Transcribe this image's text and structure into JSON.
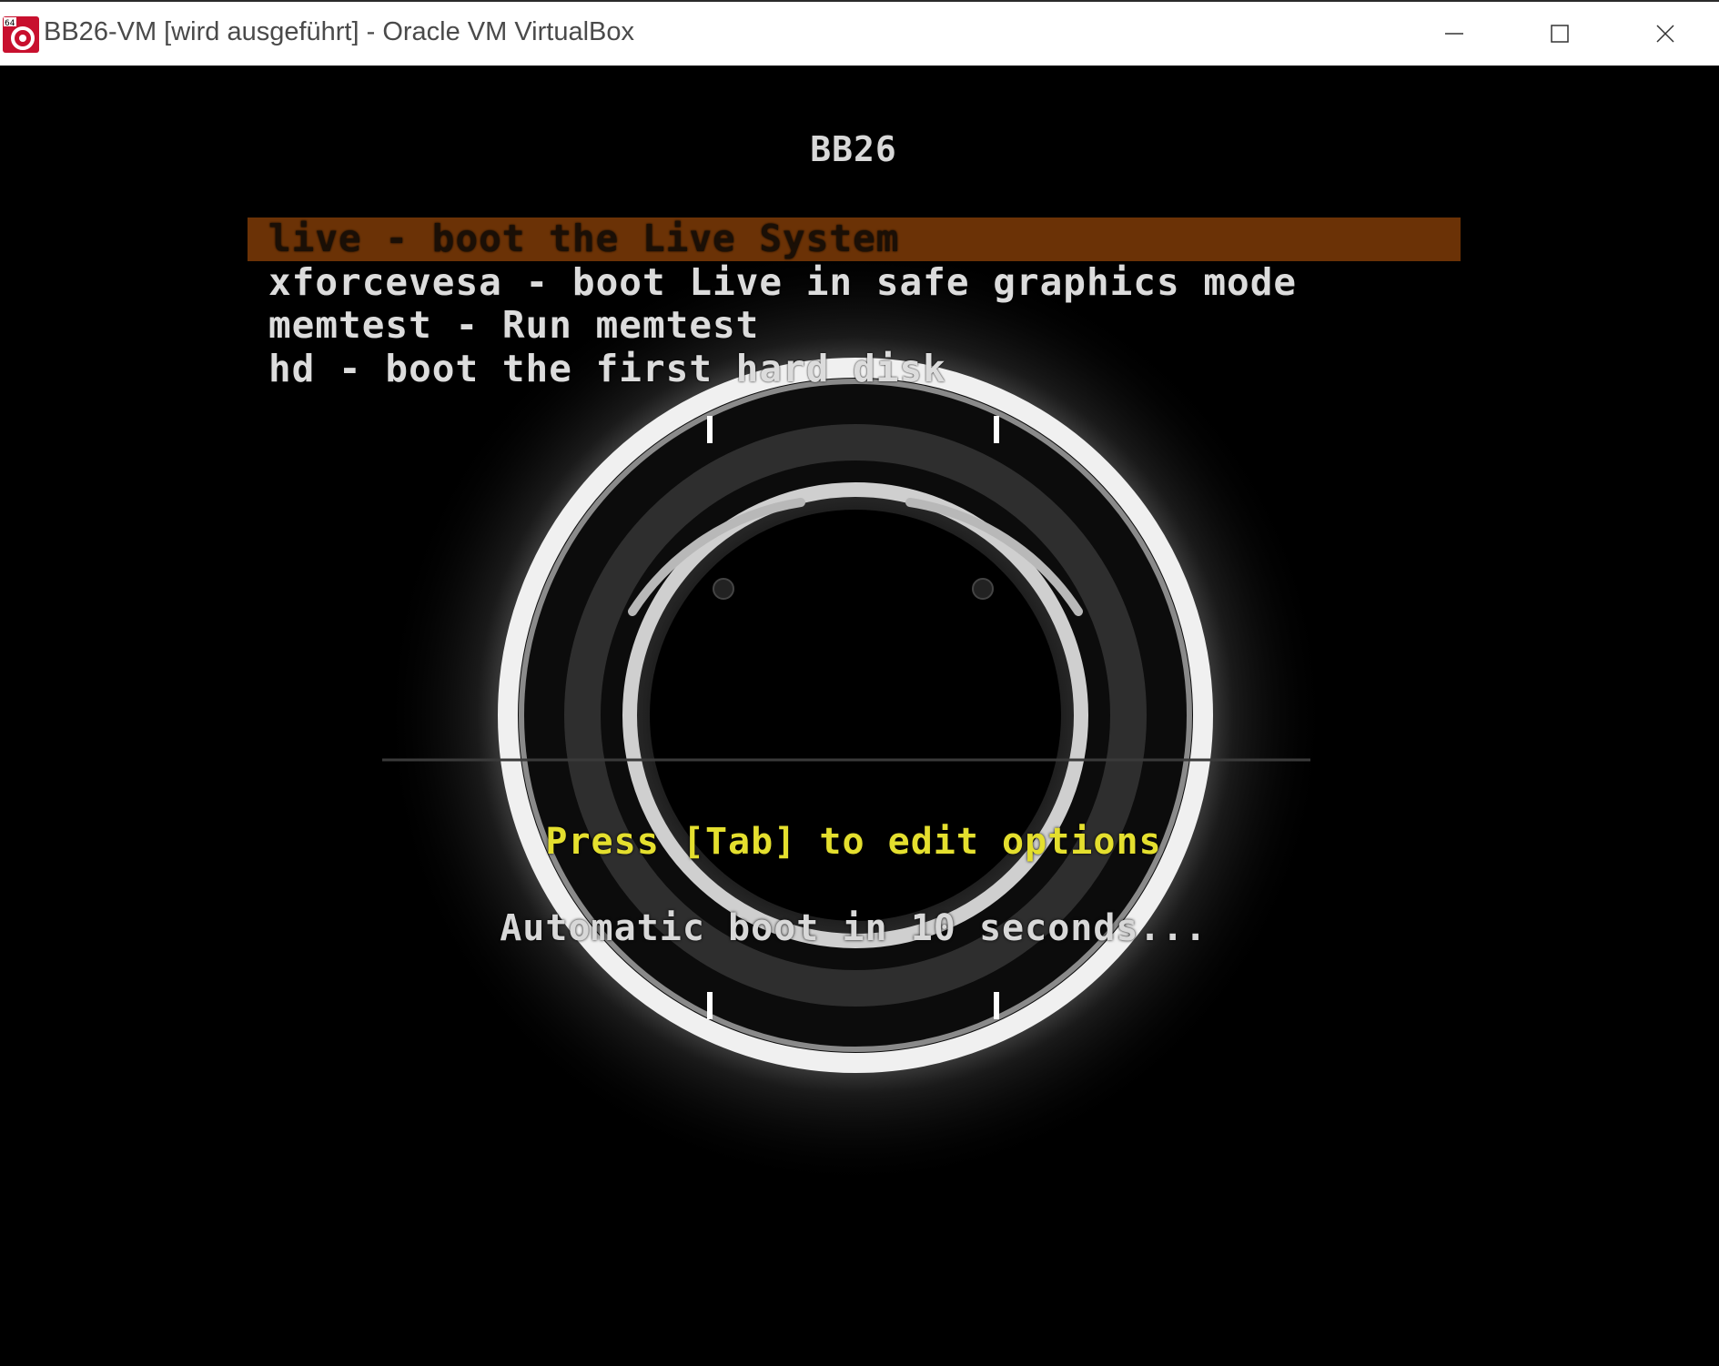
{
  "window": {
    "title": "BB26-VM [wird ausgeführt] - Oracle VM VirtualBox",
    "app_icon": "virtualbox-64-icon",
    "controls": [
      "minimize-icon",
      "maximize-icon",
      "close-icon"
    ]
  },
  "boot_menu": {
    "title": "BB26",
    "items": [
      {
        "label": "live - boot the Live System",
        "selected": true
      },
      {
        "label": "xforcevesa - boot Live in safe graphics mode",
        "selected": false
      },
      {
        "label": "memtest - Run memtest",
        "selected": false
      },
      {
        "label": "hd - boot the first hard disk",
        "selected": false
      }
    ],
    "hint": "Press [Tab] to edit options",
    "countdown": "Automatic boot in 10 seconds..."
  },
  "colors": {
    "highlight": "#6b3206",
    "hint_text": "#e4df2e",
    "menu_text": "#dcdcdc",
    "background": "#000000"
  }
}
